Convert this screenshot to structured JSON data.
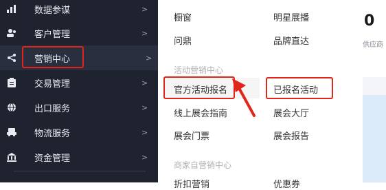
{
  "sidebar": {
    "items": [
      {
        "label": "数据参谋",
        "icon": "bar-chart-icon"
      },
      {
        "label": "客户管理",
        "icon": "users-icon"
      },
      {
        "label": "营销中心",
        "icon": "marketing-icon"
      },
      {
        "label": "交易管理",
        "icon": "clipboard-icon"
      },
      {
        "label": "出口服务",
        "icon": "globe-icon"
      },
      {
        "label": "物流服务",
        "icon": "truck-icon"
      },
      {
        "label": "资金管理",
        "icon": "bank-icon"
      }
    ],
    "chevron": ">"
  },
  "menu": {
    "row1": [
      "橱窗",
      "明星展播"
    ],
    "row2": [
      "问鼎",
      "品牌直达"
    ],
    "section1": "活动营销中心",
    "row3": [
      "官方活动报名",
      "已报名活动"
    ],
    "row4": [
      "线上展会指南",
      "展会大厅"
    ],
    "row5": [
      "展会门票",
      "展会报告"
    ],
    "section2": "商家自营销中心",
    "row6": [
      "折扣营销",
      "优惠券"
    ]
  },
  "right": {
    "big": "0",
    "small": "供应商"
  },
  "colors": {
    "sidebar_bg": "#1f2330",
    "highlight": "#e1251b"
  }
}
